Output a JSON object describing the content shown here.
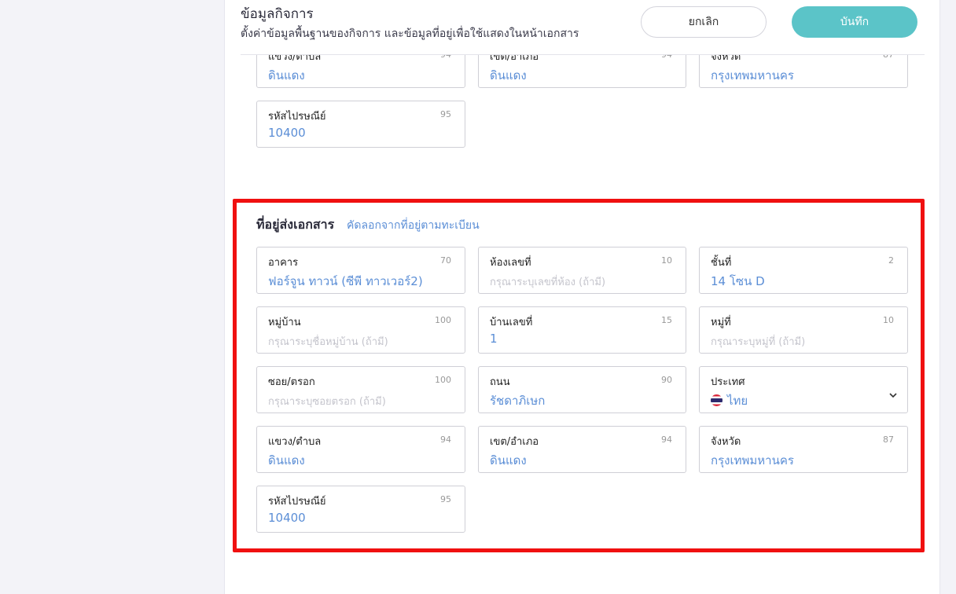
{
  "header": {
    "title": "ข้อมูลกิจการ",
    "subtitle": "ตั้งค่าข้อมูลพื้นฐานของกิจการ และข้อมูลที่อยู่เพื่อใช้แสดงในหน้าเอกสาร",
    "cancel_label": "ยกเลิก",
    "save_label": "บันทึก"
  },
  "registered_address_partial": {
    "subdistrict": {
      "label": "แขวง/ตำบล",
      "count": "94",
      "value": "ดินแดง"
    },
    "district": {
      "label": "เขต/อำเภอ",
      "count": "94",
      "value": "ดินแดง"
    },
    "province": {
      "label": "จังหวัด",
      "count": "87",
      "value": "กรุงเทพมหานคร"
    },
    "postcode": {
      "label": "รหัสไปรษณีย์",
      "count": "95",
      "value": "10400"
    }
  },
  "shipping_address": {
    "title": "ที่อยู่ส่งเอกสาร",
    "copy_link": "คัดลอกจากที่อยู่ตามทะเบียน",
    "building": {
      "label": "อาคาร",
      "count": "70",
      "value": "ฟอร์จูน ทาวน์ (ซีพี ทาวเวอร์2)"
    },
    "room": {
      "label": "ห้องเลขที่",
      "count": "10",
      "placeholder": "กรุณาระบุเลขที่ห้อง (ถ้ามี)"
    },
    "floor": {
      "label": "ชั้นที่",
      "count": "2",
      "value": "14 โซน D"
    },
    "village": {
      "label": "หมู่บ้าน",
      "count": "100",
      "placeholder": "กรุณาระบุชื่อหมู่บ้าน (ถ้ามี)"
    },
    "house_no": {
      "label": "บ้านเลขที่",
      "count": "15",
      "value": "1"
    },
    "moo": {
      "label": "หมู่ที่",
      "count": "10",
      "placeholder": "กรุณาระบุหมู่ที่ (ถ้ามี)"
    },
    "soi": {
      "label": "ซอย/ตรอก",
      "count": "100",
      "placeholder": "กรุณาระบุซอยตรอก (ถ้ามี)"
    },
    "road": {
      "label": "ถนน",
      "count": "90",
      "value": "รัชดาภิเษก"
    },
    "country": {
      "label": "ประเทศ",
      "value": "ไทย",
      "icon": "thailand-flag-icon"
    },
    "subdistrict": {
      "label": "แขวง/ตำบล",
      "count": "94",
      "value": "ดินแดง"
    },
    "district": {
      "label": "เขต/อำเภอ",
      "count": "94",
      "value": "ดินแดง"
    },
    "province": {
      "label": "จังหวัด",
      "count": "87",
      "value": "กรุงเทพมหานคร"
    },
    "postcode": {
      "label": "รหัสไปรษณีย์",
      "count": "95",
      "value": "10400"
    }
  },
  "colors": {
    "accent": "#5bc4c8",
    "value_text": "#5b8ed6",
    "highlight_border": "#f01010"
  }
}
